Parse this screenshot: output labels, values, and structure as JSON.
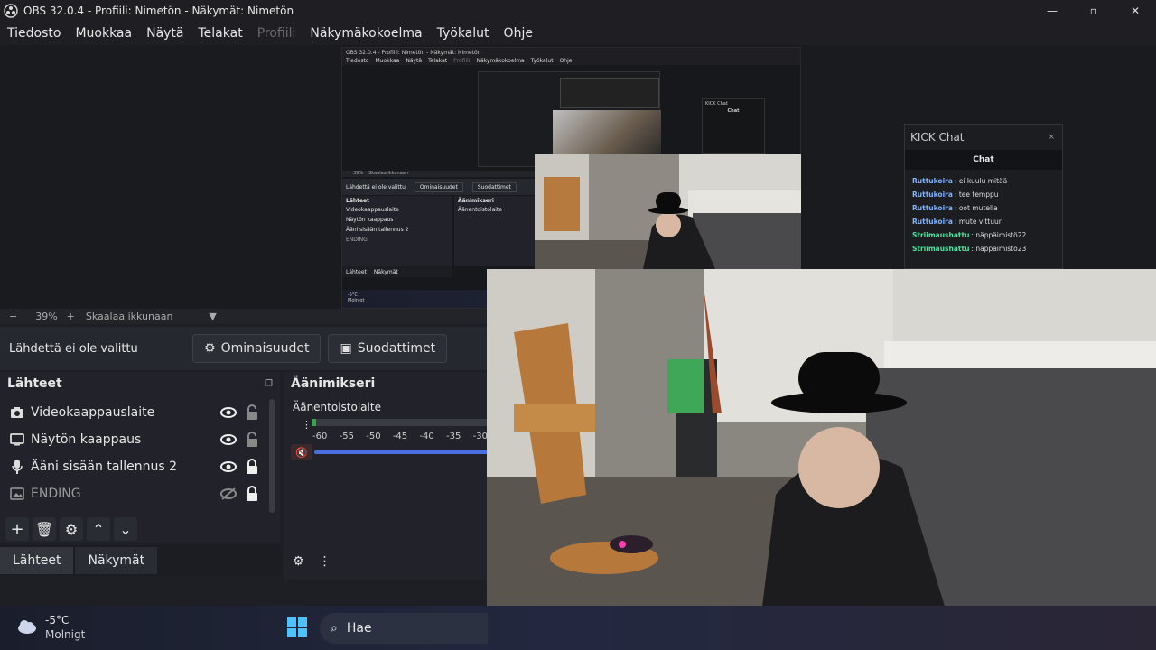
{
  "window": {
    "title": "OBS 32.0.4 - Profiili: Nimetön - Näkymät: Nimetön"
  },
  "menu": [
    "Tiedosto",
    "Muokkaa",
    "Näytä",
    "Telakat",
    "Profiili",
    "Näkymäkokoelma",
    "Työkalut",
    "Ohje"
  ],
  "zoom": {
    "level": "39%",
    "mode": "Skaalaa ikkunaan"
  },
  "source_props": {
    "status": "Lähdettä ei ole valittu",
    "properties_label": "Ominaisuudet",
    "filters_label": "Suodattimet"
  },
  "sources": {
    "title": "Lähteet",
    "items": [
      {
        "label": "Videokaappauslaite",
        "icon": "camera-icon",
        "visible": true,
        "locked": false
      },
      {
        "label": "Näytön kaappaus",
        "icon": "monitor-icon",
        "visible": true,
        "locked": false
      },
      {
        "label": "Ääni sisään tallennus 2",
        "icon": "microphone-icon",
        "visible": true,
        "locked": true
      },
      {
        "label": "ENDING",
        "icon": "image-icon",
        "visible": false,
        "locked": true
      }
    ]
  },
  "mixer": {
    "title": "Äänimikseri",
    "channel": "Äänentoistolaite",
    "ticks": [
      "-60",
      "-55",
      "-50",
      "-45",
      "-40",
      "-35",
      "-30"
    ]
  },
  "tabs": {
    "sources": "Lähteet",
    "scenes": "Näkymät"
  },
  "kick": {
    "title": "KICK Chat",
    "subtitle": "Chat",
    "messages": [
      {
        "user": "Ruttukoira",
        "text": "ei kuulu mitää",
        "color": "#7fb2ff"
      },
      {
        "user": "Ruttukoira",
        "text": "tee temppu",
        "color": "#7fb2ff"
      },
      {
        "user": "Ruttukoira",
        "text": "oot mutella",
        "color": "#7fb2ff"
      },
      {
        "user": "Ruttukoira",
        "text": "mute vittuun",
        "color": "#7fb2ff"
      },
      {
        "user": "Striimaushattu",
        "text": "näppäimistö22",
        "color": "#4fe3a0"
      },
      {
        "user": "Striimaushattu",
        "text": "näppäimistö23",
        "color": "#4fe3a0"
      }
    ]
  },
  "taskbar": {
    "temperature": "-5°C",
    "weather": "Molnigt",
    "search": "Hae"
  },
  "nested": {
    "title": "OBS 32.0.4 - Profiili: Nimetön - Näkymät: Nimetön",
    "menu": [
      "Tiedosto",
      "Muokkaa",
      "Näytä",
      "Telakat",
      "Profiili",
      "Näkymäkokoelma",
      "Työkalut",
      "Ohje"
    ],
    "zoom_level": "39%",
    "zoom_mode": "Skaalaa ikkunaan",
    "status": "Lähdettä ei ole valittu",
    "properties": "Ominaisuudet",
    "filters": "Suodattimet",
    "sources_title": "Lähteet",
    "source_items": [
      "Videokaappauslaite",
      "Näytön kaappaus",
      "Ääni sisään tallennus 2",
      "ENDING"
    ],
    "mixer_title": "Äänimikseri",
    "mixer_channel": "Äänentoistolaite",
    "tab_sources": "Lähteet",
    "tab_scenes": "Näkymät",
    "kick_title": "KICK Chat",
    "kick_sub": "Chat",
    "temp": "-5°C",
    "weather": "Molnigt"
  },
  "colors": {
    "accent": "#4a6fe0",
    "chat_user": "#7fb2ff",
    "chat_user2": "#4fe3a0"
  }
}
